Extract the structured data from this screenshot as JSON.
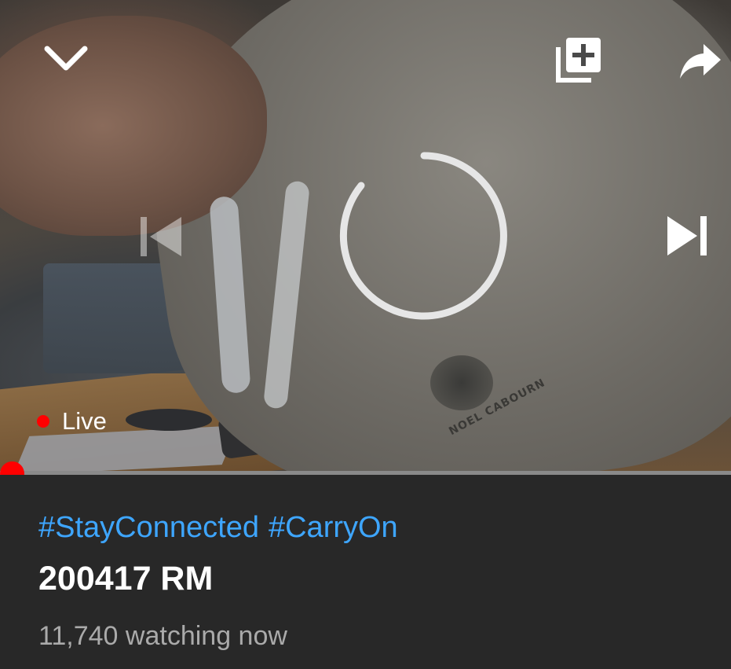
{
  "player": {
    "live_label": "Live",
    "progress": 0.0,
    "accent_color": "#ff0000",
    "controls": {
      "collapse_icon": "chevron-down-icon",
      "add_to_queue_icon": "add-to-queue-icon",
      "share_icon": "share-icon",
      "previous_icon": "skip-previous-icon",
      "next_icon": "skip-next-icon",
      "loading_icon": "loading-spinner-icon"
    },
    "scene_text": "NOEL CABOURN"
  },
  "video_info": {
    "hashtags": [
      "#StayConnected",
      "#CarryOn"
    ],
    "hashtag_color": "#3ea6ff",
    "title": "200417 RM",
    "viewers": "11,740 watching now"
  }
}
